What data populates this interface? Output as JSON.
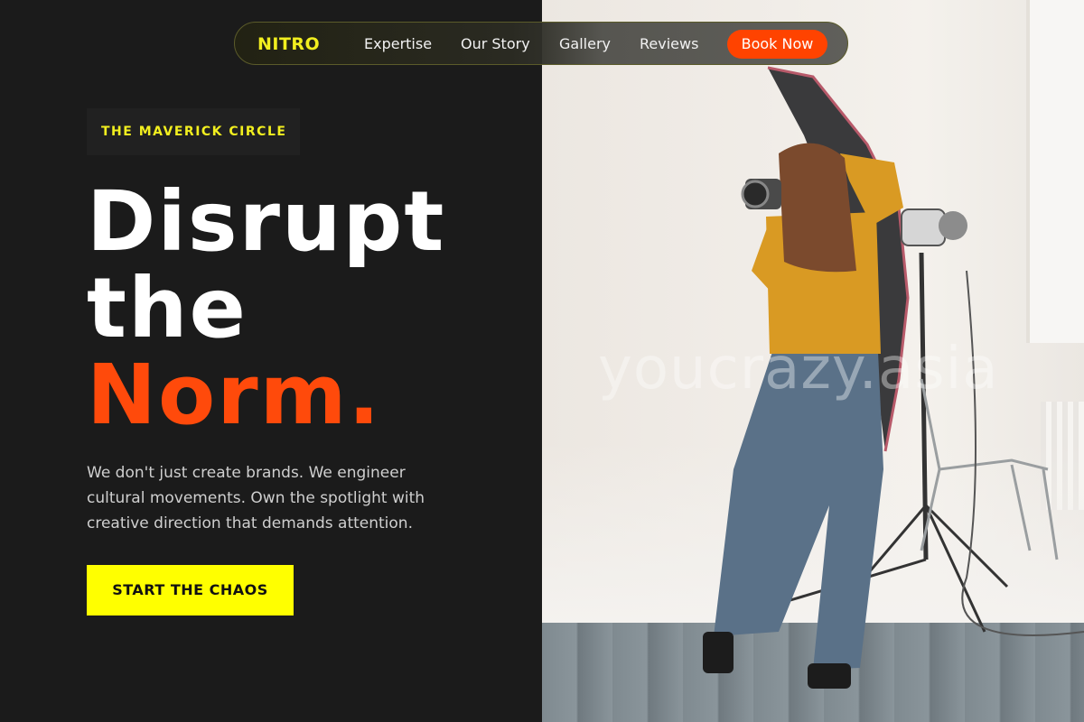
{
  "nav": {
    "brand": "NITRO",
    "links": [
      "Expertise",
      "Our Story",
      "Gallery",
      "Reviews"
    ],
    "cta": "Book Now"
  },
  "hero": {
    "tag": "THE MAVERICK CIRCLE",
    "headline_line1": "Disrupt",
    "headline_line2": "the",
    "headline_accent": "Norm.",
    "description": "We don't just create brands. We engineer cultural movements. Own the spotlight with creative direction that demands attention.",
    "button": "START THE CHAOS"
  },
  "image": {
    "watermark": "youcrazy.asia",
    "subject": "photographer-in-studio"
  },
  "colors": {
    "background": "#1b1b1b",
    "brand_yellow": "#f2ef1f",
    "accent_orange": "#ff4300",
    "button_yellow": "#ffff00"
  }
}
